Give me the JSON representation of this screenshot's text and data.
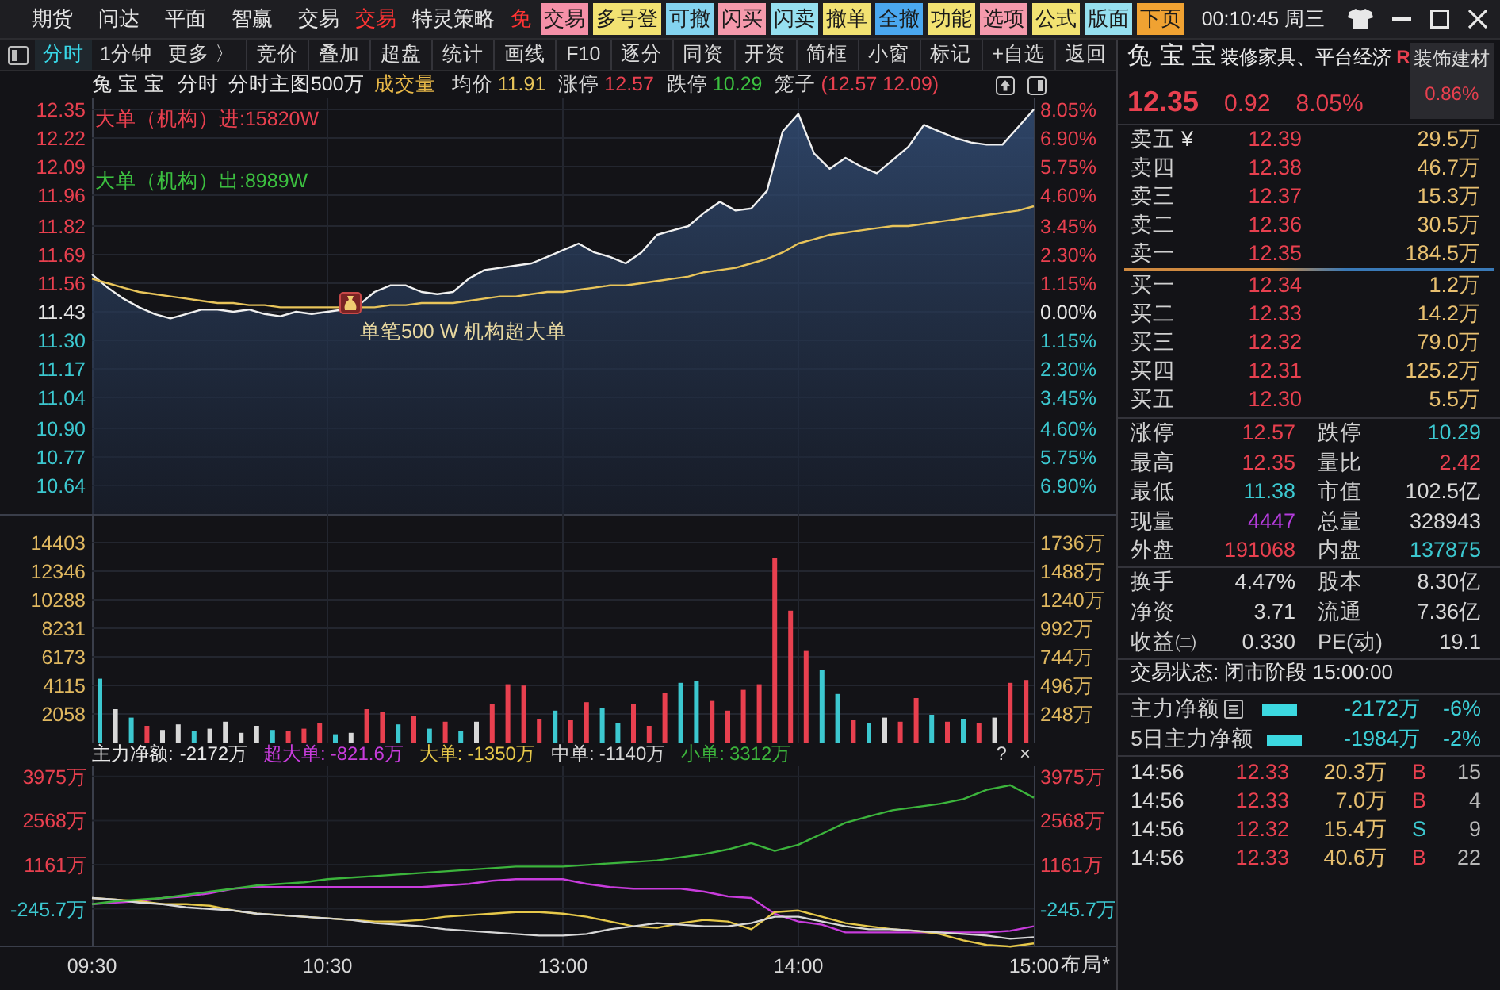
{
  "menu_bar": {
    "items": [
      {
        "label": "期货",
        "kind": "menu"
      },
      {
        "label": "问达",
        "kind": "menu"
      },
      {
        "label": "平面",
        "kind": "menu"
      },
      {
        "label": "智赢",
        "kind": "menu"
      },
      {
        "label": "交易",
        "kind": "menu"
      },
      {
        "label": "交易",
        "kind": "promo"
      },
      {
        "label": "特灵策略",
        "kind": "menu"
      },
      {
        "label": "免",
        "kind": "promo"
      }
    ]
  },
  "quick_buttons": [
    {
      "label": "交易",
      "color": "#f590a8"
    },
    {
      "label": "多号登",
      "color": "#f2e272"
    },
    {
      "label": "可撤",
      "color": "#84d4f0"
    },
    {
      "label": "闪买",
      "color": "#f59aac"
    },
    {
      "label": "闪卖",
      "color": "#96e0f0"
    },
    {
      "label": "撤单",
      "color": "#f2e272"
    },
    {
      "label": "全撤",
      "color": "#4aa8f0"
    },
    {
      "label": "功能",
      "color": "#f2e272"
    },
    {
      "label": "选项",
      "color": "#f59aac"
    },
    {
      "label": "公式",
      "color": "#f2e272"
    },
    {
      "label": "版面",
      "color": "#96e0f0"
    },
    {
      "label": "下页",
      "color": "#f0a232"
    }
  ],
  "clock": "00:10:45 周三",
  "toolbar": {
    "tabs": [
      {
        "label": "分时",
        "selected": true
      },
      {
        "label": "1分钟",
        "selected": false
      },
      {
        "label": "更多 〉",
        "selected": false
      }
    ],
    "buttons": [
      "竞价",
      "叠加",
      "超盘",
      "统计",
      "画线",
      "F10",
      "逐分",
      "同资",
      "开资",
      "简框",
      "小窗",
      "标记",
      "+自选",
      "返回"
    ]
  },
  "chart_header": {
    "stock_name": "兔 宝 宝",
    "period": "分时",
    "template": "分时主图500万",
    "volume_label": "成交量",
    "indicators": [
      {
        "label": "均价",
        "value": "11.91",
        "color": "#e8c45a"
      },
      {
        "label": "涨停",
        "value": "12.57",
        "color": "#e8404f"
      },
      {
        "label": "跌停",
        "value": "10.29",
        "color": "#3cc040"
      },
      {
        "label": "笼子",
        "value": "(12.57 12.09)",
        "color": "#e8404f"
      }
    ]
  },
  "price_chart": {
    "inflow_text": "大单（机构）进:15820W",
    "outflow_text": "大单（机构）出:8989W",
    "note": "单笔500 W 机构超大单",
    "percent_labels": [
      {
        "text": "8.05%",
        "color": "#e8404f"
      },
      {
        "text": "6.90%",
        "color": "#e8404f"
      },
      {
        "text": "5.75%",
        "color": "#e8404f"
      },
      {
        "text": "4.60%",
        "color": "#e8404f"
      },
      {
        "text": "3.45%",
        "color": "#e8404f"
      },
      {
        "text": "2.30%",
        "color": "#e8404f"
      },
      {
        "text": "1.15%",
        "color": "#e8404f"
      },
      {
        "text": "0.00%",
        "color": "#e6e6e6"
      },
      {
        "text": "1.15%",
        "color": "#3cc8d0"
      },
      {
        "text": "2.30%",
        "color": "#3cc8d0"
      },
      {
        "text": "3.45%",
        "color": "#3cc8d0"
      },
      {
        "text": "4.60%",
        "color": "#3cc8d0"
      },
      {
        "text": "5.75%",
        "color": "#3cc8d0"
      },
      {
        "text": "6.90%",
        "color": "#3cc8d0"
      }
    ],
    "chart_data": {
      "type": "area",
      "grid": true,
      "categories": [
        null,
        null,
        null,
        null,
        null,
        null,
        null,
        null,
        null,
        null,
        null,
        null,
        null,
        null,
        null,
        null,
        null,
        null,
        null,
        null,
        null,
        null,
        null,
        null,
        null,
        null,
        null,
        null,
        null,
        null,
        null,
        null,
        null,
        null,
        null,
        null,
        null,
        null,
        null,
        null,
        null,
        null,
        null,
        null,
        null,
        null,
        null,
        null,
        null,
        null,
        null,
        null,
        null,
        null,
        null,
        null,
        null,
        null,
        null,
        null,
        null
      ],
      "ylim": [
        10.51,
        12.35
      ],
      "yticks": [
        {
          "value": 12.35,
          "label": "12.35"
        },
        {
          "value": 12.22,
          "label": "12.22"
        },
        {
          "value": 12.09,
          "label": "12.09"
        },
        {
          "value": 11.96,
          "label": "11.96"
        },
        {
          "value": 11.82,
          "label": "11.82"
        },
        {
          "value": 11.69,
          "label": "11.69"
        },
        {
          "value": 11.56,
          "label": "11.56"
        },
        {
          "value": 11.43,
          "label": "11.43"
        },
        {
          "value": 11.3,
          "label": "11.30"
        },
        {
          "value": 11.17,
          "label": "11.17"
        },
        {
          "value": 11.04,
          "label": "11.04"
        },
        {
          "value": 10.9,
          "label": "10.90"
        },
        {
          "value": 10.77,
          "label": "10.77"
        },
        {
          "value": 10.64,
          "label": "10.64"
        }
      ],
      "series": [
        {
          "color": "#f0f0f0",
          "values": [
            11.6,
            11.54,
            11.49,
            11.45,
            11.42,
            11.4,
            11.42,
            11.44,
            11.44,
            11.43,
            11.44,
            11.42,
            11.41,
            11.43,
            11.42,
            11.43,
            11.44,
            11.46,
            11.52,
            11.55,
            11.55,
            11.52,
            11.51,
            11.52,
            11.58,
            11.62,
            11.63,
            11.64,
            11.65,
            11.68,
            11.71,
            11.74,
            11.7,
            11.68,
            11.65,
            11.7,
            11.78,
            11.8,
            11.82,
            11.88,
            11.93,
            11.89,
            11.9,
            11.98,
            12.25,
            12.33,
            12.15,
            12.08,
            12.13,
            12.09,
            12.06,
            12.12,
            12.18,
            12.28,
            12.25,
            12.22,
            12.2,
            12.19,
            12.19,
            12.27,
            12.35
          ]
        },
        {
          "type": "line",
          "color": "#e8c45a",
          "values": [
            11.58,
            11.56,
            11.54,
            11.52,
            11.51,
            11.5,
            11.49,
            11.48,
            11.47,
            11.47,
            11.46,
            11.46,
            11.45,
            11.45,
            11.45,
            11.45,
            11.45,
            11.45,
            11.45,
            11.46,
            11.46,
            11.47,
            11.47,
            11.47,
            11.48,
            11.49,
            11.5,
            11.5,
            11.51,
            11.52,
            11.52,
            11.53,
            11.54,
            11.55,
            11.55,
            11.56,
            11.57,
            11.58,
            11.59,
            11.61,
            11.62,
            11.63,
            11.65,
            11.67,
            11.7,
            11.74,
            11.76,
            11.78,
            11.79,
            11.8,
            11.81,
            11.82,
            11.82,
            11.83,
            11.84,
            11.85,
            11.86,
            11.87,
            11.88,
            11.89,
            11.91
          ]
        }
      ]
    }
  },
  "volume_chart": {
    "right_labels": [
      "1736万",
      "1488万",
      "1240万",
      "992万",
      "744万",
      "496万",
      "248万"
    ],
    "chart_data": {
      "type": "bar",
      "grid": true,
      "categories": [
        null,
        null,
        null,
        null,
        null,
        null,
        null,
        null,
        null,
        null,
        null,
        null,
        null,
        null,
        null,
        null,
        null,
        null,
        null,
        null,
        null,
        null,
        null,
        null,
        null,
        null,
        null,
        null,
        null,
        null,
        null,
        null,
        null,
        null,
        null,
        null,
        null,
        null,
        null,
        null,
        null,
        null,
        null,
        null,
        null,
        null,
        null,
        null,
        null,
        null,
        null,
        null,
        null,
        null,
        null,
        null,
        null,
        null,
        null,
        null
      ],
      "ylim": [
        0,
        16460
      ],
      "yticks": [
        14403,
        12346,
        10288,
        8231,
        6173,
        4115,
        2058
      ],
      "stacked": true,
      "series": [
        {
          "color": "#e8404f",
          "values": [
            null,
            null,
            null,
            1200,
            null,
            null,
            null,
            null,
            null,
            null,
            null,
            null,
            800,
            1000,
            1400,
            null,
            null,
            2400,
            2200,
            null,
            1900,
            null,
            1500,
            null,
            null,
            2800,
            4200,
            4100,
            1700,
            null,
            1600,
            2900,
            null,
            null,
            2800,
            1200,
            3600,
            null,
            null,
            3000,
            2300,
            3800,
            4200,
            13300,
            9500,
            6600,
            null,
            null,
            1600,
            null,
            null,
            1500,
            3200,
            null,
            1500,
            null,
            1400,
            null,
            4300,
            4500
          ]
        },
        {
          "color": "#3cc8d0",
          "values": [
            4600,
            null,
            1800,
            null,
            null,
            null,
            800,
            null,
            null,
            null,
            null,
            900,
            null,
            null,
            null,
            600,
            null,
            null,
            null,
            1300,
            null,
            1000,
            null,
            800,
            null,
            null,
            null,
            null,
            null,
            2300,
            null,
            null,
            2500,
            1400,
            null,
            null,
            null,
            4300,
            4400,
            null,
            null,
            null,
            null,
            null,
            null,
            null,
            5200,
            3500,
            null,
            1400,
            null,
            null,
            null,
            2000,
            null,
            1700,
            null,
            null,
            null,
            null
          ]
        },
        {
          "color": "#d8d8d8",
          "values": [
            null,
            2400,
            null,
            null,
            900,
            1300,
            null,
            1000,
            1500,
            700,
            1200,
            null,
            null,
            null,
            null,
            null,
            700,
            null,
            null,
            null,
            null,
            null,
            null,
            null,
            1500,
            null,
            null,
            null,
            null,
            null,
            null,
            null,
            null,
            null,
            null,
            null,
            null,
            null,
            null,
            null,
            null,
            null,
            null,
            null,
            null,
            null,
            null,
            null,
            null,
            null,
            1800,
            null,
            null,
            null,
            null,
            null,
            null,
            1800,
            null,
            null
          ]
        }
      ]
    }
  },
  "money_flow": {
    "net_label": "主力净额:",
    "net_value": "-2172万",
    "legend": [
      {
        "label": "超大单:",
        "value": "-821.6万"
      },
      {
        "label": "大单:",
        "value": "-1350万"
      },
      {
        "label": "中单:",
        "value": "-1140万"
      },
      {
        "label": "小单:",
        "value": "3312万"
      }
    ],
    "help": "?",
    "close": "×",
    "right_labels": [
      "3975万",
      "2568万",
      "1161万",
      "-245.7万"
    ],
    "layout_button": "布局*",
    "chart_data": {
      "type": "line",
      "grid": true,
      "categories": [
        "09:30",
        null,
        null,
        null,
        null,
        null,
        null,
        null,
        null,
        null,
        "10:30",
        null,
        null,
        null,
        null,
        null,
        null,
        null,
        null,
        null,
        "13:00",
        null,
        null,
        null,
        null,
        null,
        null,
        null,
        null,
        null,
        "14:00",
        null,
        null,
        null,
        null,
        null,
        null,
        null,
        null,
        null,
        "15:00"
      ],
      "ylim": [
        -1470,
        4300
      ],
      "yticks": [
        {
          "value": 3975,
          "label": "3975万"
        },
        {
          "value": 2568,
          "label": "2568万"
        },
        {
          "value": 1161,
          "label": "1161万"
        },
        {
          "value": -245.7,
          "label": "-245.7万"
        }
      ],
      "series": [
        {
          "color": "#c83cdc",
          "values": [
            -100,
            -50,
            0,
            100,
            150,
            250,
            400,
            450,
            450,
            450,
            450,
            450,
            450,
            450,
            450,
            500,
            550,
            650,
            700,
            700,
            700,
            550,
            450,
            400,
            400,
            400,
            300,
            150,
            100,
            -400,
            -650,
            -750,
            -1000,
            -1000,
            -1000,
            -1000,
            -1000,
            -1000,
            -1000,
            -950,
            -800
          ]
        },
        {
          "color": "#e6c84a",
          "values": [
            100,
            50,
            0,
            -100,
            -100,
            -150,
            -300,
            -400,
            -450,
            -500,
            -550,
            -600,
            -650,
            -650,
            -600,
            -500,
            -450,
            -400,
            -350,
            -350,
            -400,
            -500,
            -650,
            -800,
            -850,
            -700,
            -600,
            -650,
            -900,
            -350,
            -300,
            -500,
            -700,
            -800,
            -900,
            -950,
            -1050,
            -1250,
            -1400,
            -1450,
            -1350
          ]
        },
        {
          "color": "#d8d8d8",
          "values": [
            100,
            50,
            -50,
            -100,
            -200,
            -250,
            -300,
            -400,
            -450,
            -500,
            -550,
            -600,
            -700,
            -750,
            -800,
            -900,
            -950,
            -1000,
            -1050,
            -1100,
            -1100,
            -1050,
            -900,
            -800,
            -700,
            -750,
            -800,
            -800,
            -700,
            -500,
            -500,
            -650,
            -800,
            -900,
            -900,
            -950,
            -1000,
            -1050,
            -1100,
            -1200,
            -1150
          ]
        },
        {
          "color": "#3cb43c",
          "values": [
            -100,
            0,
            50,
            100,
            200,
            300,
            400,
            500,
            550,
            600,
            700,
            750,
            800,
            850,
            900,
            950,
            1000,
            1050,
            1100,
            1100,
            1100,
            1150,
            1200,
            1250,
            1300,
            1400,
            1500,
            1650,
            1850,
            1600,
            1800,
            2150,
            2500,
            2700,
            2900,
            3000,
            3100,
            3250,
            3550,
            3700,
            3300
          ]
        }
      ]
    }
  },
  "quote_panel": {
    "name": "兔 宝 宝",
    "concepts": "装修家具、平台经济",
    "flag": "R",
    "sector": {
      "name": "装饰建材",
      "change": "0.86%"
    },
    "price": "12.35",
    "change": "0.92",
    "change_pct": "8.05%",
    "asks": [
      {
        "label": "卖五",
        "mark": "¥",
        "price": "12.39",
        "volume": "29.5万"
      },
      {
        "label": "卖四",
        "price": "12.38",
        "volume": "46.7万"
      },
      {
        "label": "卖三",
        "price": "12.37",
        "volume": "15.3万"
      },
      {
        "label": "卖二",
        "price": "12.36",
        "volume": "30.5万"
      },
      {
        "label": "卖一",
        "price": "12.35",
        "volume": "184.5万"
      }
    ],
    "bids": [
      {
        "label": "买一",
        "price": "12.34",
        "volume": "1.2万"
      },
      {
        "label": "买二",
        "price": "12.33",
        "volume": "14.2万"
      },
      {
        "label": "买三",
        "price": "12.32",
        "volume": "79.0万"
      },
      {
        "label": "买四",
        "price": "12.31",
        "volume": "125.2万"
      },
      {
        "label": "买五",
        "price": "12.30",
        "volume": "5.5万"
      }
    ],
    "stats": [
      {
        "label": "涨停",
        "value": "12.57",
        "color": "#e8404f"
      },
      {
        "label": "跌停",
        "value": "10.29",
        "color": "#3cc8d0"
      },
      {
        "label": "最高",
        "value": "12.35",
        "color": "#e8404f"
      },
      {
        "label": "量比",
        "value": "2.42",
        "color": "#e8404f"
      },
      {
        "label": "最低",
        "value": "11.38",
        "color": "#3cc8d0"
      },
      {
        "label": "市值",
        "value": "102.5亿",
        "color": "#d8d8d8"
      },
      {
        "label": "现量",
        "value": "4447",
        "color": "#b43cdc"
      },
      {
        "label": "总量",
        "value": "328943",
        "color": "#d8d8d8"
      },
      {
        "label": "外盘",
        "value": "191068",
        "color": "#e8404f"
      },
      {
        "label": "内盘",
        "value": "137875",
        "color": "#3cc8d0"
      }
    ],
    "fundamentals": [
      {
        "label": "换手",
        "value": "4.47%"
      },
      {
        "label": "股本",
        "value": "8.30亿"
      },
      {
        "label": "净资",
        "value": "3.71"
      },
      {
        "label": "流通",
        "value": "7.36亿"
      },
      {
        "label": "收益㈡",
        "value": "0.330"
      },
      {
        "label": "PE(动)",
        "value": "19.1"
      }
    ],
    "status": "交易状态: 闭市阶段 15:00:00",
    "main_flow": [
      {
        "label": "主力净额",
        "detail_icon": true,
        "value": "-2172万",
        "pct": "-6%"
      },
      {
        "label": "5日主力净额",
        "detail_icon": false,
        "value": "-1984万",
        "pct": "-2%"
      }
    ],
    "trades": [
      {
        "time": "14:56",
        "price": "12.33",
        "amount": "20.3万",
        "side": "B",
        "kind": "buy",
        "count": "15"
      },
      {
        "time": "14:56",
        "price": "12.33",
        "amount": "7.0万",
        "side": "B",
        "kind": "buy",
        "count": "4"
      },
      {
        "time": "14:56",
        "price": "12.32",
        "amount": "15.4万",
        "side": "S",
        "kind": "sell",
        "count": "9"
      },
      {
        "time": "14:56",
        "price": "12.33",
        "amount": "40.6万",
        "side": "B",
        "kind": "buy",
        "count": "22"
      }
    ]
  }
}
